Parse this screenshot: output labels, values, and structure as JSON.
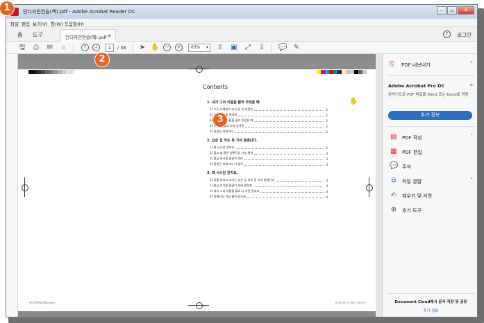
{
  "window": {
    "title": "인디자인연습(책).pdf - Adobe Acrobat Reader DC",
    "controls": [
      "–",
      "▭",
      "✕"
    ]
  },
  "menu": [
    "파일",
    "편집",
    "보기(V)",
    "창(W)",
    "도움말(H)"
  ],
  "tabs": {
    "home": "홈",
    "tools": "도구",
    "doc": "인디자인연습(책).pdf",
    "close": "×"
  },
  "header": {
    "help": "?",
    "login": "로그인"
  },
  "toolbar": {
    "page_current": "1",
    "page_total": "/ 38",
    "zoom": "63%"
  },
  "document": {
    "toc_title": "Contents",
    "sections": [
      {
        "title": "1. 내가 그의 이름을 불러 주었을 때",
        "entries": [
          {
            "text": "1) 그는 나에게로 와서 꽃 이 되었다",
            "page": "2"
          },
          {
            "text": "2) 꽃은 누구를 위하여",
            "page": "2"
          },
          {
            "text": "3) 내가 그의 이름을 불러 주었을 때",
            "page": "2"
          },
          {
            "text": "4) 이 봄의 꽃과 추억 일색한",
            "page": "2"
          },
          {
            "text": "5) 관용은 미래이다",
            "page": "2"
          }
        ]
      },
      {
        "title": "2. 넘은 십 리도 못 가서 발병난다.",
        "entries": [
          {
            "text": "1) 떠 나시던 뭇지요",
            "page": "2"
          },
          {
            "text": "2) 좁고 넓 통한 일편단심 가실 줄이",
            "page": "3"
          },
          {
            "text": "3) 황금 보기를 돌같이 하라",
            "page": "3"
          },
          {
            "text": "4) 관용은 미래이다 이 봄이",
            "page": "3"
          }
        ]
      },
      {
        "title": "3. 때 사시던 뭇지요.",
        "entries": [
          {
            "text": "1) 나를 버리고 가시는 님은 십 리도 못 가서 발병난다",
            "page": "3"
          },
          {
            "text": "2) 황금 보기를 돌같이 하라 원작판",
            "page": "4"
          },
          {
            "text": "3) 내가 그의 이름을 불러 나 사던 뭇지요",
            "page": "4"
          },
          {
            "text": "4) 일편단심 가실 줄이 있으랴",
            "page": "4"
          }
        ]
      }
    ],
    "footer_left": "인디자인연습(책).indd 1",
    "footer_right": "2015-03-23 오후 1:20:03"
  },
  "panel": {
    "header": "PDF 내보내기",
    "promo_title": "Adobe Acrobat Pro DC",
    "promo_text": "온라인으로 PDF 파일을 Word 또는 Excel로 변환",
    "promo_button": "추가 정보",
    "tools": [
      {
        "label": "PDF 작성",
        "icon": "pdf-create-icon",
        "chevron": true
      },
      {
        "label": "PDF 편집",
        "icon": "pdf-edit-icon",
        "chevron": false
      },
      {
        "label": "주석",
        "icon": "comment-icon",
        "chevron": false
      },
      {
        "label": "파일 결합",
        "icon": "combine-files-icon",
        "chevron": true
      },
      {
        "label": "채우기 및 서명",
        "icon": "fill-sign-icon",
        "chevron": false
      },
      {
        "label": "추가 도구",
        "icon": "more-tools-icon",
        "chevron": false
      }
    ],
    "bottom_note": "Document Cloud에서 문서 저장 및 공유",
    "bottom_link": "추가 정보"
  },
  "badges": [
    "1",
    "2",
    "3"
  ],
  "colors": {
    "accent": "#2d6ebd",
    "badge": "#e8631e",
    "acrobat_red": "#c8102e"
  }
}
